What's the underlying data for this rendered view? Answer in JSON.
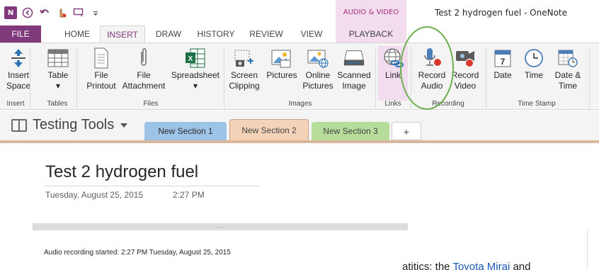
{
  "titlebar": {
    "app_icon": "onenote-logo-icon",
    "app_icon_letters": "N",
    "qat": [
      "back-icon",
      "undo-icon",
      "touch-mode-icon",
      "dock-icon",
      "customize-icon"
    ],
    "context_group": "AUDIO & VIDEO",
    "title": "Test 2 hydrogen fuel - OneNote"
  },
  "tabs": [
    "FILE",
    "HOME",
    "INSERT",
    "DRAW",
    "HISTORY",
    "REVIEW",
    "VIEW",
    "PLAYBACK"
  ],
  "ribbon": {
    "insert_space": [
      "Insert",
      "Space"
    ],
    "table": [
      "Table",
      "▾"
    ],
    "file_printout": [
      "File",
      "Printout"
    ],
    "file_attachment": [
      "File",
      "Attachment"
    ],
    "spreadsheet": [
      "Spreadsheet",
      "▾"
    ],
    "screen_clipping": [
      "Screen",
      "Clipping"
    ],
    "pictures": "Pictures",
    "online_pictures": [
      "Online",
      "Pictures"
    ],
    "scanned_image": [
      "Scanned",
      "Image"
    ],
    "link": "Link",
    "record_audio": [
      "Record",
      "Audio"
    ],
    "record_video": [
      "Record",
      "Video"
    ],
    "date": "Date",
    "time": "Time",
    "date_time": [
      "Date &",
      "Time"
    ],
    "groups": [
      "Insert",
      "Tables",
      "Files",
      "Images",
      "Links",
      "Recording",
      "Time Stamp"
    ]
  },
  "notebook": {
    "name": "Testing Tools",
    "sections": [
      "New Section 1",
      "New Section 2",
      "New Section 3",
      "+"
    ]
  },
  "page": {
    "title": "Test 2 hydrogen fuel",
    "date": "Tuesday, August 25, 2015",
    "time": "2:27 PM",
    "handle": "....",
    "note": "Audio recording started: 2:27 PM Tuesday, August 25, 2015",
    "bg_fragment_before": "atitics: the ",
    "bg_fragment_link": "Toyota Mirai",
    "bg_fragment_after": " and"
  },
  "colors": {
    "accent": "#80397b",
    "context_tab": "#f3dced",
    "section_1": "#9dc3e6",
    "section_2": "#f4d3b8",
    "section_3": "#b7dd9a",
    "annotation_circle": "#6ab04c"
  }
}
